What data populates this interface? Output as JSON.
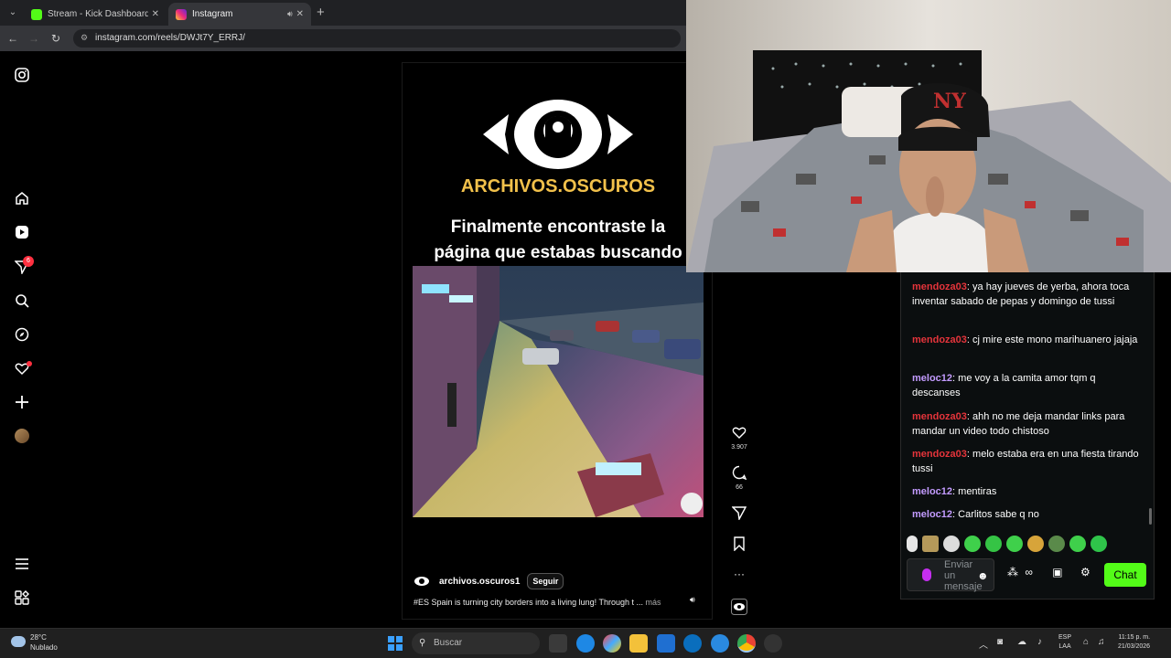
{
  "browser": {
    "tabs": [
      {
        "title": "Stream - Kick Dashboard"
      },
      {
        "title": "Instagram"
      }
    ],
    "url": "instagram.com/reels/DWJt7Y_ERRJ/"
  },
  "instagram": {
    "sidebar": {
      "notifications_badge": "6"
    },
    "reel": {
      "brand": "ARCHIVOS.OSCUROS",
      "headline_line1": "Finalmente encontraste la",
      "headline_line2": "página que estabas buscando",
      "author": "archivos.oscuros1",
      "follow_label": "Seguir",
      "caption": "#ES Spain is turning city borders into a living lung! Through t ...",
      "more_label": "más",
      "likes": "3.907",
      "comments": "66"
    }
  },
  "chat": {
    "messages": [
      {
        "user": "mendoza03",
        "text": "ya hay jueves de yerba, ahora toca inventar sabado de pepas y domingo de tussi"
      },
      {
        "user": "mendoza03",
        "text": "cj mire este mono marihuanero jajaja"
      },
      {
        "user": "meloc12",
        "text": "me voy a la camita amor tqm q descanses"
      },
      {
        "user": "mendoza03",
        "text": "ahh no me deja mandar links para mandar un video todo chistoso"
      },
      {
        "user": "mendoza03",
        "text": "melo estaba era en una fiesta tirando tussi"
      },
      {
        "user": "meloc12",
        "text": "mentiras"
      },
      {
        "user": "meloc12",
        "text": "Carlitos sabe q no"
      }
    ],
    "input_placeholder": "Enviar un mensaje",
    "send_label": "Chat"
  },
  "taskbar": {
    "temperature": "28°C",
    "weather": "Nublado",
    "search_placeholder": "Buscar",
    "lang_line1": "ESP",
    "lang_line2": "LAA",
    "time": "11:15 p. m.",
    "date": "21/03/2026"
  },
  "colors": {
    "kick_green": "#53fc18",
    "badge_red": "#ff3040",
    "brand_gold": "#f2c14b",
    "user_red": "#e5343b",
    "user_purple": "#c39bff"
  }
}
